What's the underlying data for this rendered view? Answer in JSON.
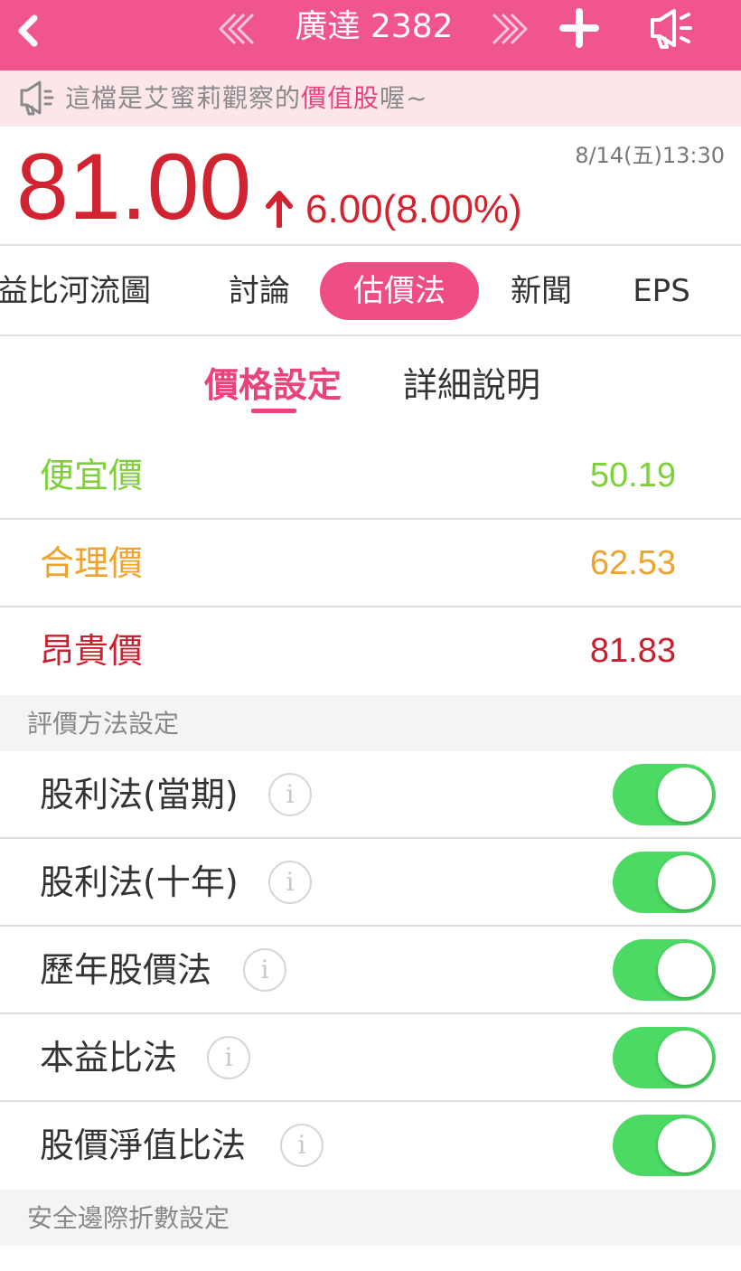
{
  "header": {
    "title": "廣達 2382",
    "background": "#f0558e"
  },
  "notice": {
    "text_before": "這檔是艾蜜莉觀察的",
    "highlight": "價值股",
    "text_after": "喔~"
  },
  "quote": {
    "price": "81.00",
    "change": "6.00(8.00%)",
    "datetime": "8/14(五)13:30",
    "color": "#d22430"
  },
  "tabs": [
    {
      "label": "益比河流圖",
      "active": false
    },
    {
      "label": "討論",
      "active": false
    },
    {
      "label": "估價法",
      "active": true
    },
    {
      "label": "新聞",
      "active": false
    },
    {
      "label": "EPS",
      "active": false
    }
  ],
  "subtabs": [
    {
      "label": "價格設定",
      "active": true
    },
    {
      "label": "詳細說明",
      "active": false
    }
  ],
  "prices": [
    {
      "label": "便宜價",
      "value": "50.19",
      "color": "#7ed03a"
    },
    {
      "label": "合理價",
      "value": "62.53",
      "color": "#f0a22e"
    },
    {
      "label": "昂貴價",
      "value": "81.83",
      "color": "#c8202e"
    }
  ],
  "valuation_section": {
    "title": "評價方法設定"
  },
  "methods": [
    {
      "label": "股利法(當期)",
      "info": "i",
      "enabled": true
    },
    {
      "label": "股利法(十年)",
      "info": "i",
      "enabled": true
    },
    {
      "label": "歷年股價法",
      "info": "i",
      "enabled": true
    },
    {
      "label": "本益比法",
      "info": "i",
      "enabled": true
    },
    {
      "label": "股價淨值比法",
      "info": "i",
      "enabled": true
    }
  ],
  "margin_section": {
    "title": "安全邊際折數設定"
  },
  "toggle_color": "#4cd964"
}
